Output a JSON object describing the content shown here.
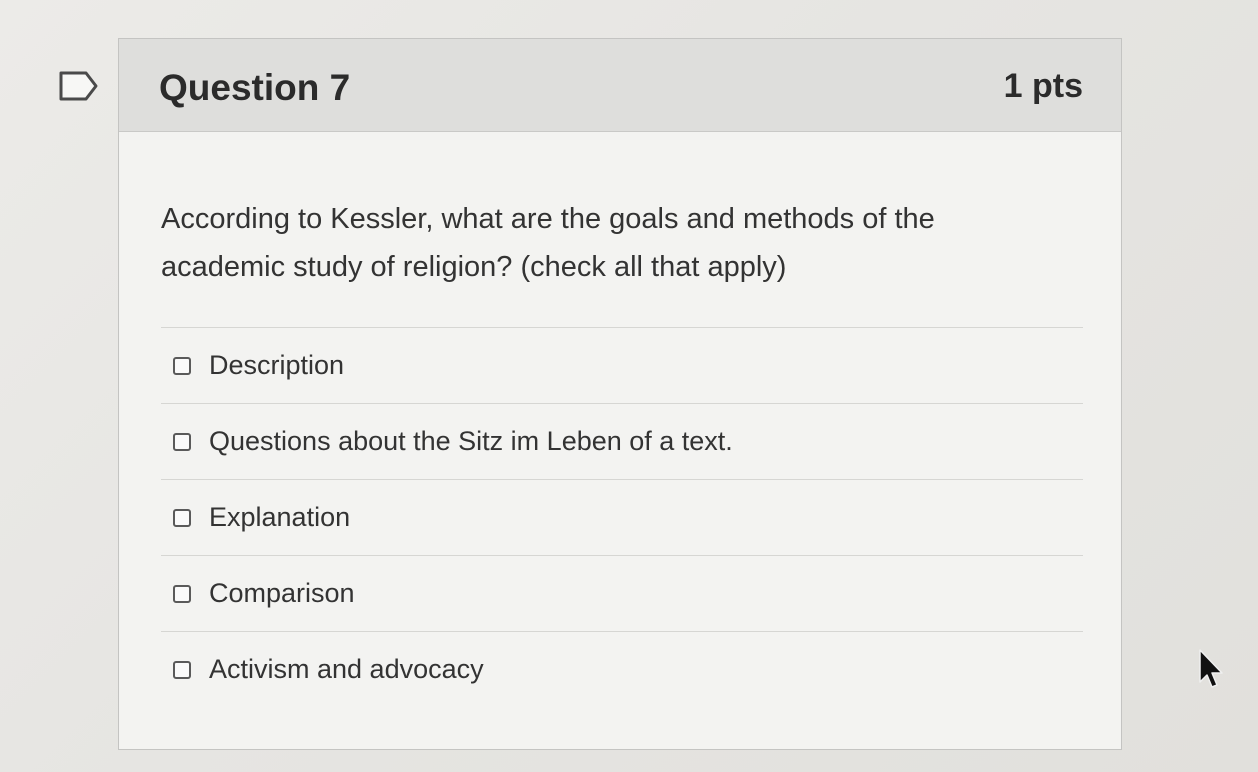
{
  "question": {
    "title": "Question 7",
    "points": "1 pts",
    "text": "According to Kessler, what are the goals and methods of the academic study of religion? (check all that apply)"
  },
  "answers": [
    {
      "label": "Description",
      "checked": false
    },
    {
      "label": "Questions about the Sitz im Leben of a text.",
      "checked": false
    },
    {
      "label": "Explanation",
      "checked": false
    },
    {
      "label": "Comparison",
      "checked": false
    },
    {
      "label": "Activism and advocacy",
      "checked": false
    }
  ],
  "icons": {
    "flag": "bookmark-flag-icon",
    "cursor": "mouse-pointer-icon"
  }
}
